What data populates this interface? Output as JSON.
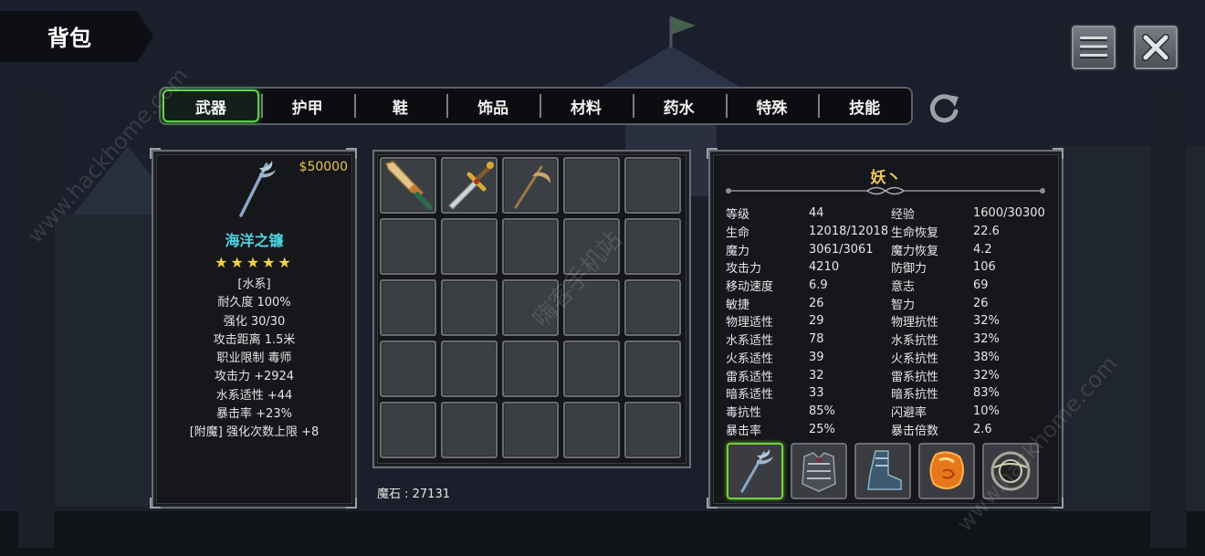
{
  "header": {
    "title": "背包"
  },
  "top_buttons": {
    "menu_icon": "hamburger-menu-icon",
    "close_icon": "close-x-icon"
  },
  "tabs": [
    "武器",
    "护甲",
    "鞋",
    "饰品",
    "材料",
    "药水",
    "特殊",
    "技能"
  ],
  "active_tab_index": 0,
  "item_detail": {
    "price": "$50000",
    "name": "海洋之镰",
    "stars": "★★★★★",
    "lines": [
      "[水系]",
      "耐久度 100%",
      "强化 30/30",
      "攻击距离  1.5米",
      "职业限制  毒师",
      "攻击力  +2924",
      "水系适性  +44",
      "暴击率  +23%",
      "[附魔] 强化次数上限 +8"
    ]
  },
  "inventory": {
    "items": [
      "golden-sword-icon",
      "ornate-dagger-icon",
      "scythe-icon"
    ],
    "magic_stone": "魔石 : 27131"
  },
  "character": {
    "name": "妖丶",
    "stats": [
      [
        "等级",
        "44",
        "经验",
        "1600/30300"
      ],
      [
        "生命",
        "12018/12018",
        "生命恢复",
        "22.6"
      ],
      [
        "魔力",
        "3061/3061",
        "魔力恢复",
        "4.2"
      ],
      [
        "攻击力",
        "4210",
        "防御力",
        "106"
      ],
      [
        "移动速度",
        "6.9",
        "意志",
        "69"
      ],
      [
        "敏捷",
        "26",
        "智力",
        "26"
      ],
      [
        "物理适性",
        "29",
        "物理抗性",
        "32%"
      ],
      [
        "水系适性",
        "78",
        "水系抗性",
        "32%"
      ],
      [
        "火系适性",
        "39",
        "火系抗性",
        "38%"
      ],
      [
        "雷系适性",
        "32",
        "雷系抗性",
        "32%"
      ],
      [
        "暗系适性",
        "33",
        "暗系抗性",
        "83%"
      ],
      [
        "毒抗性",
        "85%",
        "闪避率",
        "10%"
      ],
      [
        "暴击率",
        "25%",
        "暴击倍数",
        "2.6"
      ]
    ],
    "equipment": [
      "scythe-icon",
      "chest-armor-icon",
      "boots-icon",
      "amber-gem-icon",
      "ring-icon"
    ]
  },
  "watermarks": [
    "www.hackhome.com",
    "嗨客手机站",
    "www.hackhome.com"
  ],
  "colors": {
    "active_tab_border": "#5fd24a",
    "item_name": "#4fd6e6",
    "price": "#e9c25a",
    "char_name": "#f2c85a"
  }
}
